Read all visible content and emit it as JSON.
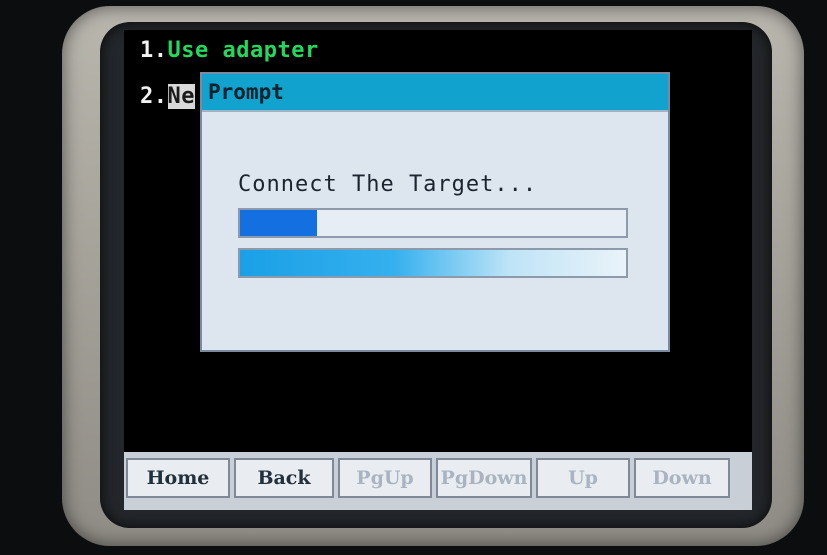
{
  "menu": {
    "item1_num": "1.",
    "item1_text": "Use adapter",
    "item2_num": "2.",
    "item2_text": "Ne"
  },
  "dialog": {
    "title": "Prompt",
    "message": "Connect The Target...",
    "progress1": 0.2,
    "progress2": 1.0
  },
  "softkeys": [
    {
      "label": "Home",
      "enabled": true
    },
    {
      "label": "Back",
      "enabled": true
    },
    {
      "label": "PgUp",
      "enabled": false
    },
    {
      "label": "PgDown",
      "enabled": false
    },
    {
      "label": "Up",
      "enabled": false
    },
    {
      "label": "Down",
      "enabled": false
    }
  ],
  "colors": {
    "menu_text": "#22d85f",
    "dialog_title_bar": "#11a3cd",
    "progress_fill": "#1470e0"
  }
}
